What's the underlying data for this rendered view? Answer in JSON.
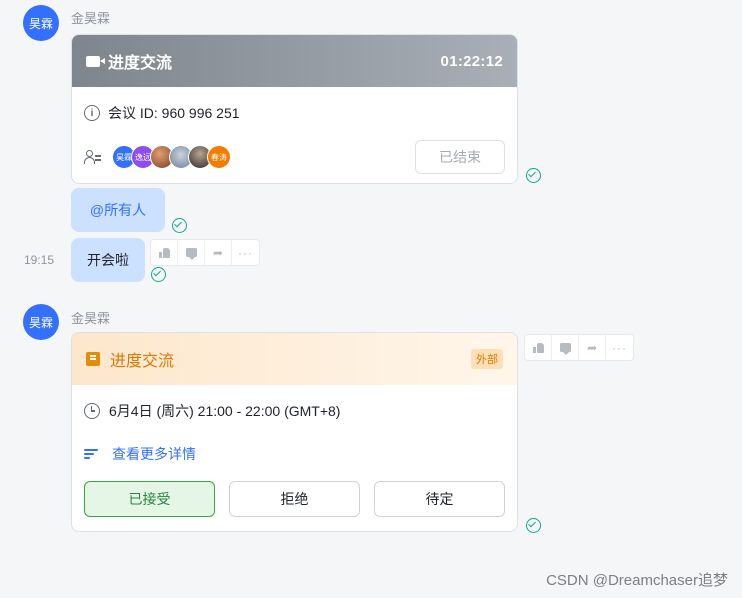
{
  "messages": [
    {
      "sender": "金昊霖",
      "avatar_text": "昊霖",
      "meeting_card": {
        "title": "进度交流",
        "duration": "01:22:12",
        "meeting_id_label": "会议 ID: 960 996 251",
        "participants": [
          {
            "text": "昊霖",
            "color": "#3370ff"
          },
          {
            "text": "逸远",
            "color": "#8e4cf2"
          },
          {
            "text": "",
            "color": "#a0522d"
          },
          {
            "text": "",
            "color": "#7d8fa3"
          },
          {
            "text": "",
            "color": "#3b3b3b"
          },
          {
            "text": "春涛",
            "color": "#f57c00"
          }
        ],
        "ended_button": "已结束"
      }
    }
  ],
  "bubbles": [
    {
      "text": "@所有人"
    },
    {
      "text": "开会啦",
      "time": "19:15"
    }
  ],
  "message_actions": {
    "icons": [
      "thumbs-up-icon",
      "comment-icon",
      "forward-icon",
      "more-icon"
    ],
    "more_text": "···",
    "forward_text": "➦"
  },
  "calendar_message": {
    "sender": "金昊霖",
    "avatar_text": "昊霖",
    "card": {
      "title": "进度交流",
      "external_badge": "外部",
      "time_text": "6月4日 (周六) 21:00 - 22:00 (GMT+8)",
      "details_link": "查看更多详情",
      "rsvp": {
        "accept": "已接受",
        "decline": "拒绝",
        "tentative": "待定"
      }
    }
  },
  "watermark": "CSDN @Dreamchaser追梦",
  "colors": {
    "accent": "#3370ff",
    "bubble": "#cce0ff",
    "read": "#14a88a",
    "calendar_orange": "#de7802",
    "accepted_green": "#34a845"
  }
}
